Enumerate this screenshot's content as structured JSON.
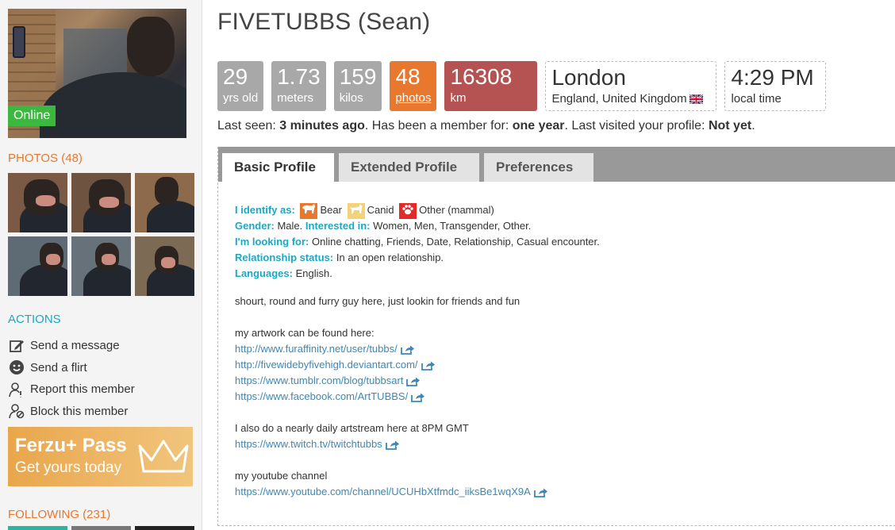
{
  "sidebar": {
    "online_label": "Online",
    "photos_title": "PHOTOS (48)",
    "actions_title": "ACTIONS",
    "actions": [
      {
        "label": "Send a message",
        "icon": "edit-icon"
      },
      {
        "label": "Send a flirt",
        "icon": "smiley-icon"
      },
      {
        "label": "Report this member",
        "icon": "report-user-icon"
      },
      {
        "label": "Block this member",
        "icon": "block-user-icon"
      }
    ],
    "pass": {
      "title": "Ferzu+ Pass",
      "subtitle": "Get yours today",
      "icon": "crown-icon"
    },
    "following_title": "FOLLOWING (231)"
  },
  "profile": {
    "name": "FIVETUBBS (Sean)",
    "stats": [
      {
        "value": "29",
        "unit": "yrs old"
      },
      {
        "value": "1.73",
        "unit": "meters"
      },
      {
        "value": "159",
        "unit": "kilos"
      },
      {
        "value": "48",
        "unit": "photos"
      },
      {
        "value": "16308",
        "unit": "km"
      }
    ],
    "location": {
      "city": "London",
      "region": "England, United Kingdom",
      "flag_icon": "uk-flag-icon"
    },
    "time": {
      "value": "4:29 PM",
      "label": "local time"
    },
    "lastseen": {
      "p1": "Last seen: ",
      "v1": "3 minutes ago",
      "p2": ". Has been a member for: ",
      "v2": "one year",
      "p3": ". Last visited your profile: ",
      "v3": "Not yet",
      "p4": "."
    }
  },
  "tabs": [
    {
      "label": "Basic Profile",
      "active": true
    },
    {
      "label": "Extended Profile",
      "active": false
    },
    {
      "label": "Preferences",
      "active": false
    }
  ],
  "basic": {
    "identify_label": "I identify as:",
    "species": [
      {
        "name": "Bear",
        "icon": "bear-icon"
      },
      {
        "name": "Canid",
        "icon": "canid-icon"
      },
      {
        "name": "Other (mammal)",
        "icon": "paw-icon"
      }
    ],
    "gender_label": "Gender:",
    "gender_value": "Male.",
    "interested_label": "Interested in:",
    "interested_value": "Women, Men, Transgender, Other.",
    "looking_label": "I'm looking for:",
    "looking_value": "Online chatting, Friends, Date, Relationship, Casual encounter.",
    "relationship_label": "Relationship status:",
    "relationship_value": "In an open relationship.",
    "languages_label": "Languages:",
    "languages_value": "English."
  },
  "about": {
    "intro": "shourt, round and furry guy here, just lookin for friends and fun",
    "artwork_heading": "my artwork can be found here:",
    "artwork_links": [
      "http://www.furaffinity.net/user/tubbs/",
      "http://fivewidebyfivehigh.deviantart.com/",
      "https://www.tumblr.com/blog/tubbsart",
      "https://www.facebook.com/ArtTUBBS/"
    ],
    "stream_heading": "I also do a nearly daily artstream here at 8PM GMT",
    "stream_link": "https://www.twitch.tv/twitchtubbs",
    "youtube_heading": "my youtube channel",
    "youtube_link": "https://www.youtube.com/channel/UCUHbXtfmdc_iiksBe1wqX9A"
  },
  "colors": {
    "accent_orange": "#e8782d",
    "teal": "#1ba8c4",
    "online_green": "#3cb840",
    "distance_red": "#b55252",
    "link_blue": "#3d88b5"
  }
}
